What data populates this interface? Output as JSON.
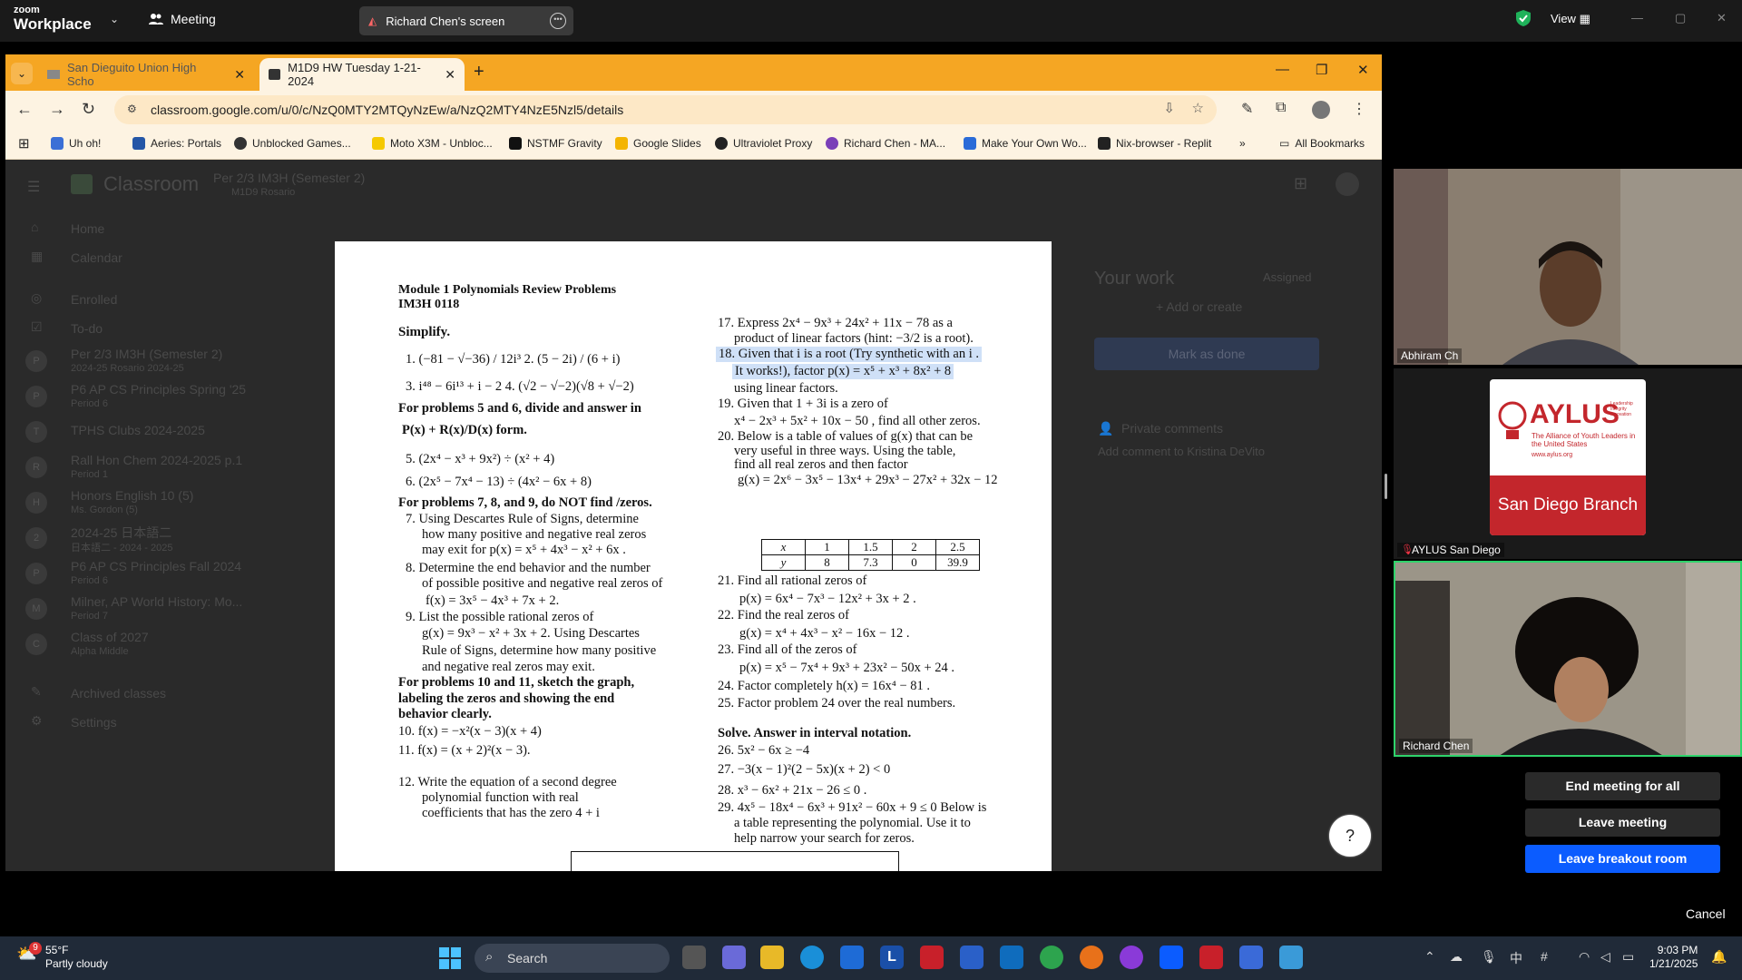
{
  "zoom": {
    "logo_top": "zoom",
    "logo_bottom": "Workplace",
    "meeting_label": "Meeting",
    "share_label": "Richard Chen's screen",
    "view_label": "View",
    "shield_color": "#1fb25a"
  },
  "browser": {
    "tabs": [
      {
        "label": "San Dieguito Union High Scho"
      },
      {
        "label": "M1D9 HW Tuesday 1-21-2024"
      }
    ],
    "url": "classroom.google.com/u/0/c/NzQ0MTY2MTQyNzEw/a/NzQ2MTY4NzE5Nzl5/details",
    "bookmarks": [
      {
        "label": "Uh oh!",
        "color": "#3b6fd6"
      },
      {
        "label": "Aeries: Portals",
        "color": "#2456a6"
      },
      {
        "label": "Unblocked Games...",
        "color": "#333"
      },
      {
        "label": "Moto X3M - Unbloc...",
        "color": "#f5c900"
      },
      {
        "label": "NSTMF Gravity",
        "color": "#111"
      },
      {
        "label": "Google Slides",
        "color": "#f4b400"
      },
      {
        "label": "Ultraviolet Proxy",
        "color": "#222"
      },
      {
        "label": "Richard Chen - MA...",
        "color": "#7b3fb8"
      },
      {
        "label": "Make Your Own Wo...",
        "color": "#2a6bd8"
      },
      {
        "label": "Nix-browser - Replit",
        "color": "#222"
      }
    ],
    "all_bookmarks": "All Bookmarks"
  },
  "classroom": {
    "course_title": "Per 2/3 IM3H (Semester 2)",
    "course_sub": "M1D9 Rosario",
    "app_name": "Classroom",
    "nav": [
      "Home",
      "Calendar",
      "Enrolled",
      "To-do"
    ],
    "courses": [
      {
        "initial": "P",
        "name": "Per 2/3 IM3H (Semester 2)",
        "sub": "2024-25 Rosario 2024-25"
      },
      {
        "initial": "P",
        "name": "P6 AP CS Principles Spring '25",
        "sub": "Period 6"
      },
      {
        "initial": "T",
        "name": "TPHS Clubs 2024-2025",
        "sub": ""
      },
      {
        "initial": "R",
        "name": "Rall Hon Chem 2024-2025 p.1",
        "sub": "Period 1"
      },
      {
        "initial": "H",
        "name": "Honors English 10 (5)",
        "sub": "Ms. Gordon (5)"
      },
      {
        "initial": "2",
        "name": "2024-25 日本語二",
        "sub": "日本語二 - 2024 - 2025"
      },
      {
        "initial": "P",
        "name": "P6 AP CS Principles Fall 2024",
        "sub": "Period 6"
      },
      {
        "initial": "M",
        "name": "Milner, AP World History: Mo...",
        "sub": "Period 7"
      },
      {
        "initial": "C",
        "name": "Class of 2027",
        "sub": "Alpha Middle"
      }
    ],
    "archived": "Archived classes",
    "settings": "Settings",
    "your_work": "Your work",
    "assigned": "Assigned",
    "add_or_create": "+ Add or create",
    "mark_as_done": "Mark as done",
    "private_comments": "Private comments",
    "add_comment": "Add comment to Kristina DeVito"
  },
  "doc": {
    "header1": "Module 1 Polynomials Review Problems",
    "header2": "IM3H 0118",
    "simplify": "Simplify.",
    "left": [
      "1.   (−81 − √−36) / 12i³        2.   (5 − 2i) / (6 + i)",
      "3.   i⁴⁸ − 6i¹³ + i − 2       4.   (√2 − √−2)(√8 + √−2)",
      "For problems 5 and 6, divide and answer in",
      "P(x) + R(x)/D(x)  form.",
      "5.   (2x⁴ − x³ + 9x²) ÷ (x² + 4)",
      "6.   (2x⁵ − 7x⁴ − 13) ÷ (4x² − 6x + 8)",
      "For problems 7, 8, and 9, do NOT find /zeros.",
      "7.  Using Descartes Rule of Signs, determine",
      "how many positive and negative real zeros",
      "may exit for  p(x) = x⁵ + 4x³ − x² + 6x .",
      "8.  Determine the end behavior and the number",
      "of possible positive and negative real zeros of",
      "f(x) = 3x⁵ − 4x³ + 7x + 2.",
      "9.  List the possible rational zeros of",
      "g(x) = 9x³ − x² + 3x + 2. Using Descartes",
      "Rule of Signs, determine how many positive",
      "and negative real zeros may exit.",
      "For problems 10 and 11, sketch the graph,",
      "labeling the zeros and showing the end",
      "behavior clearly.",
      "10.  f(x) = −x²(x − 3)(x + 4)",
      "11.  f(x) = (x + 2)²(x − 3).",
      "12.  Write the equation of a second degree",
      "polynomial function with real",
      "coefficients that has the zero 4 + i"
    ],
    "right": [
      "17.  Express  2x⁴ − 9x³ + 24x² + 11x − 78  as a",
      "product of linear factors (hint: −3/2 is a root).",
      "18.  Given that i is a root (Try synthetic with an i .",
      "It works!), factor  p(x) = x⁵ + x³ + 8x² + 8",
      "using linear factors.",
      "19.  Given that 1 + 3i  is a zero of",
      "x⁴ − 2x³ + 5x² + 10x − 50 , find all other zeros.",
      "20.  Below is a table of values of  g(x)  that can be",
      "very useful in three ways.  Using the table,",
      "find all real zeros and then factor",
      "g(x) = 2x⁶ − 3x⁵ − 13x⁴ + 29x³ − 27x² + 32x − 12",
      "21.  Find all rational zeros of",
      "p(x) = 6x⁴ − 7x³ − 12x² + 3x + 2 .",
      "22.  Find the real zeros of",
      "g(x) = x⁴ + 4x³ − x² − 16x − 12 .",
      "23.  Find all of the zeros of",
      "p(x) = x⁵ − 7x⁴ + 9x³ + 23x² − 50x + 24 .",
      "24.  Factor completely  h(x) = 16x⁴ − 81 .",
      "25.  Factor  problem 24 over the real numbers.",
      "Solve.  Answer in interval notation.",
      "26.  5x² − 6x ≥ −4",
      "27.  −3(x − 1)²(2 − 5x)(x + 2) < 0",
      "28.  x³ − 6x² + 21x − 26 ≤ 0 .",
      "29.  4x⁵ − 18x⁴ − 6x³ + 91x² − 60x + 9 ≤ 0  Below is",
      "a table representing the polynomial.  Use it to",
      "help narrow your search for zeros."
    ],
    "table": {
      "x": [
        "x",
        "1",
        "1.5",
        "2",
        "2.5"
      ],
      "y": [
        "y",
        "8",
        "7.3",
        "0",
        "39.9"
      ]
    }
  },
  "participants": [
    {
      "name": "Abhiram Ch"
    },
    {
      "name": "AYLUS San Diego",
      "card_title": "AYLUS",
      "card_tag": "The Alliance of Youth Leaders in the United States",
      "card_tag2": "Leadership Integrity Innovation",
      "card_url": "www.aylus.org",
      "card_branch": "San Diego Branch"
    },
    {
      "name": "Richard Chen"
    }
  ],
  "menu": {
    "end_all": "End meeting for all",
    "leave": "Leave meeting",
    "leave_breakout": "Leave breakout room",
    "cancel": "Cancel"
  },
  "taskbar": {
    "temp": "55°F",
    "weather": "Partly cloudy",
    "badge": "9",
    "search": "Search",
    "time": "9:03 PM",
    "date": "1/21/2025",
    "ime": "中"
  }
}
